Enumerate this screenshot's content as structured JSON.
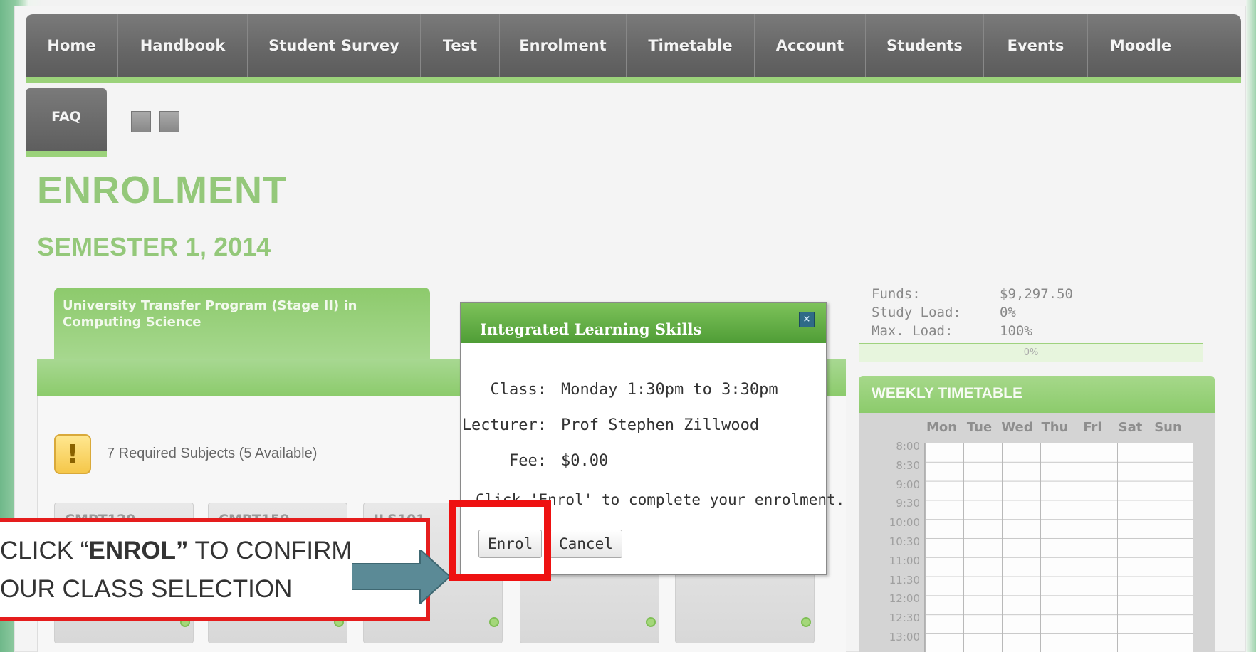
{
  "nav": {
    "items": [
      "Home",
      "Handbook",
      "Student Survey",
      "Test",
      "Enrolment",
      "Timetable",
      "Account",
      "Students",
      "Events",
      "Moodle"
    ],
    "faq": "FAQ"
  },
  "page": {
    "title": "ENROLMENT",
    "subtitle": "SEMESTER 1, 2014"
  },
  "program": {
    "name": "University Transfer Program (Stage II) in Computing Science",
    "required": "7 Required Subjects (5 Available)",
    "subjects": [
      "CMPT120",
      "CMPT150",
      "ILS101"
    ]
  },
  "account": {
    "funds_label": "Funds:",
    "funds_value": "$9,297.50",
    "study_load_label": "Study Load:",
    "study_load_value": "0%",
    "max_load_label": "Max. Load:",
    "max_load_value": "100%",
    "load_bar_text": "0%",
    "load_fraction": 0
  },
  "timetable": {
    "title": "WEEKLY TIMETABLE",
    "days": [
      "Mon",
      "Tue",
      "Wed",
      "Thu",
      "Fri",
      "Sat",
      "Sun"
    ],
    "times": [
      "8:00",
      "8:30",
      "9:00",
      "9:30",
      "10:00",
      "10:30",
      "11:00",
      "11:30",
      "12:00",
      "12:30",
      "13:00"
    ]
  },
  "modal": {
    "title": "Integrated Learning Skills",
    "class_label": "Class:",
    "class_value": "Monday 1:30pm to 3:30pm",
    "lecturer_label": "Lecturer:",
    "lecturer_value": "Prof Stephen Zillwood",
    "fee_label": "Fee:",
    "fee_value": "$0.00",
    "message": "Click 'Enrol' to complete your enrolment.",
    "enrol_label": "Enrol",
    "cancel_label": "Cancel"
  },
  "annotation": {
    "line1_prefix": "CLICK “",
    "line1_bold": "ENROL”",
    "line1_suffix": " TO CONFIRM",
    "line2": "OUR CLASS SELECTION",
    "highlight_color": "#ee1111",
    "arrow_color": "#5b8a96"
  },
  "colors": {
    "accent_green": "#94c87a",
    "nav_gray": "#666666"
  }
}
